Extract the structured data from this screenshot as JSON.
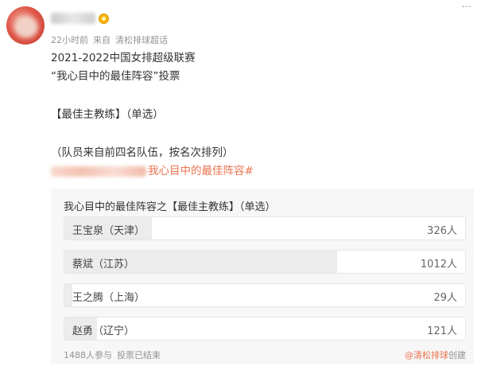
{
  "header": {
    "more_icon": "···",
    "time": "22小时前",
    "source_prefix": "来自",
    "source": "清松排球超话"
  },
  "post": {
    "line1": "2021-2022中国女排超级联赛",
    "line2": "“我心目中的最佳阵容”投票",
    "line3": "【最佳主教练】（单选）",
    "line4": "（队员来自前四名队伍，按名次排列）",
    "hashtag": "我心目中的最佳阵容#"
  },
  "poll": {
    "title": "我心目中的最佳阵容之【最佳主教练】（单选）",
    "options": [
      {
        "label": "王宝泉（天津）",
        "count": "326人",
        "share": 0.219
      },
      {
        "label": "蔡斌（江苏）",
        "count": "1012人",
        "share": 0.68
      },
      {
        "label": "王之腾（上海）",
        "count": "29人",
        "share": 0.019
      },
      {
        "label": "赵勇（辽宁）",
        "count": "121人",
        "share": 0.081
      }
    ],
    "participants": "1488人参与",
    "status": "投票已结束",
    "creator": "@清松排球",
    "creator_suffix": "创建"
  },
  "colors": {
    "accent": "#eb7350",
    "card_bg": "#f7f7f7",
    "bar_fill": "#ececec"
  }
}
